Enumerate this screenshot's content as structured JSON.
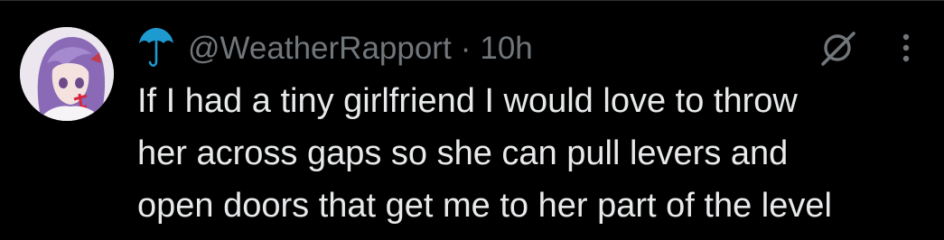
{
  "post": {
    "handle": "@WeatherRapport",
    "separator": "·",
    "timestamp": "10h",
    "text_lines": [
      "If I had a tiny girlfriend I would love to throw",
      "her across gaps so she can pull levers and",
      "open doors that get me to her part of the level"
    ]
  },
  "icons": {
    "name_emoji": "umbrella-icon",
    "action": "grok-icon",
    "more": "more-dots-icon"
  },
  "colors": {
    "background": "#000000",
    "primary_text": "#e7e9ea",
    "secondary_text": "#71767b",
    "umbrella": "#1d9bd1"
  }
}
